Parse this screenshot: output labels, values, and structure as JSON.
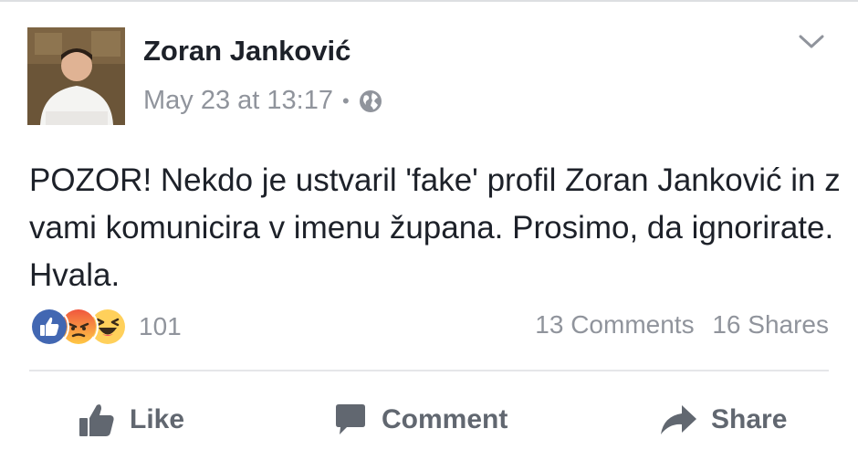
{
  "post": {
    "author": "Zoran Janković",
    "timestamp": "May 23 at 13:17",
    "separator": "•",
    "privacy_icon": "globe-icon",
    "text": "POZOR! Nekdo je ustvaril 'fake' profil Zoran Janković in z vami komunicira v imenu župana. Prosimo, da ignorirate. Hvala.",
    "options_icon": "chevron-down-icon"
  },
  "reactions": {
    "types": [
      "like",
      "angry",
      "haha"
    ],
    "count": "101"
  },
  "stats": {
    "comments": "13 Comments",
    "shares": "16 Shares"
  },
  "actions": {
    "like": "Like",
    "comment": "Comment",
    "share": "Share"
  },
  "colors": {
    "like_blue": "#4267b2",
    "angry_orange": "#f3793b",
    "haha_yellow": "#ffd05b",
    "muted_text": "#90949c",
    "action_gray": "#616770"
  }
}
